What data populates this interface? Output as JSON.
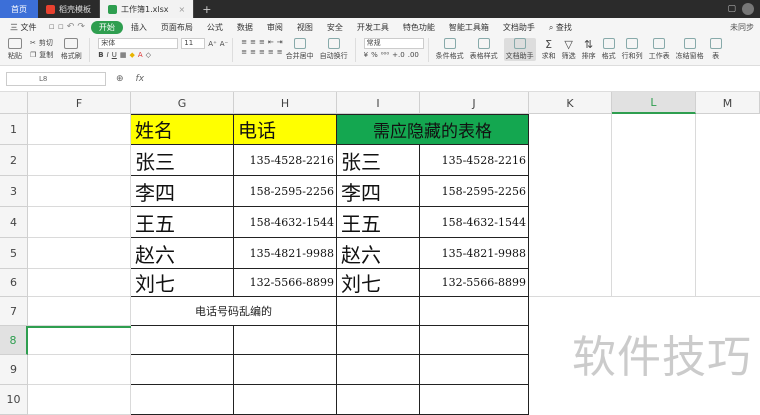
{
  "titlebar": {
    "home": "首页",
    "tabs": [
      {
        "label": "稻壳模板",
        "color": "#e8412f"
      },
      {
        "label": "工作簿1.xlsx",
        "color": "#2e9e4f"
      }
    ],
    "plus": "+",
    "close": "×"
  },
  "menu": {
    "file": "三 文件",
    "items": [
      "开始",
      "插入",
      "页面布局",
      "公式",
      "数据",
      "审阅",
      "视图",
      "安全",
      "开发工具",
      "特色功能",
      "智能工具箱",
      "文档助手"
    ],
    "search": "查找",
    "sync": "未同步"
  },
  "ribbon": {
    "paste": "粘贴",
    "cut": "剪切",
    "copy": "复制",
    "format_painter": "格式刷",
    "font": "宋体",
    "font_size": "11",
    "number_format": "常规",
    "merge": "合并居中",
    "wrap": "自动换行",
    "cond_format": "条件格式",
    "table_style": "表格样式",
    "doc_helper": "文档助手",
    "sum": "求和",
    "filter": "筛选",
    "sort": "排序",
    "format": "格式",
    "rows_cols": "行和列",
    "worksheet": "工作表",
    "freeze": "冻结窗格",
    "table": "表"
  },
  "formula_bar": {
    "cell_ref": "L8",
    "fx": "fx",
    "content": ""
  },
  "columns": [
    "F",
    "G",
    "H",
    "I",
    "J",
    "K",
    "L",
    "M"
  ],
  "selected_column": "L",
  "rows": [
    "1",
    "2",
    "3",
    "4",
    "5",
    "6",
    "7",
    "8",
    "9",
    "10"
  ],
  "selected_row": "8",
  "sheet": {
    "head_name": "姓名",
    "head_phone": "电话",
    "head_hidden": "需应隐藏的表格",
    "names": [
      "张三",
      "李四",
      "王五",
      "赵六",
      "刘七"
    ],
    "phones": [
      "135-4528-2216",
      "158-2595-2256",
      "158-4632-1544",
      "135-4821-9988",
      "132-5566-8899"
    ],
    "note": "电话号码乱编的"
  },
  "colors": {
    "yellow_header": "#ffff00",
    "green_header": "#14a750",
    "accent": "#2e9e4f"
  },
  "watermark": "软件技巧"
}
